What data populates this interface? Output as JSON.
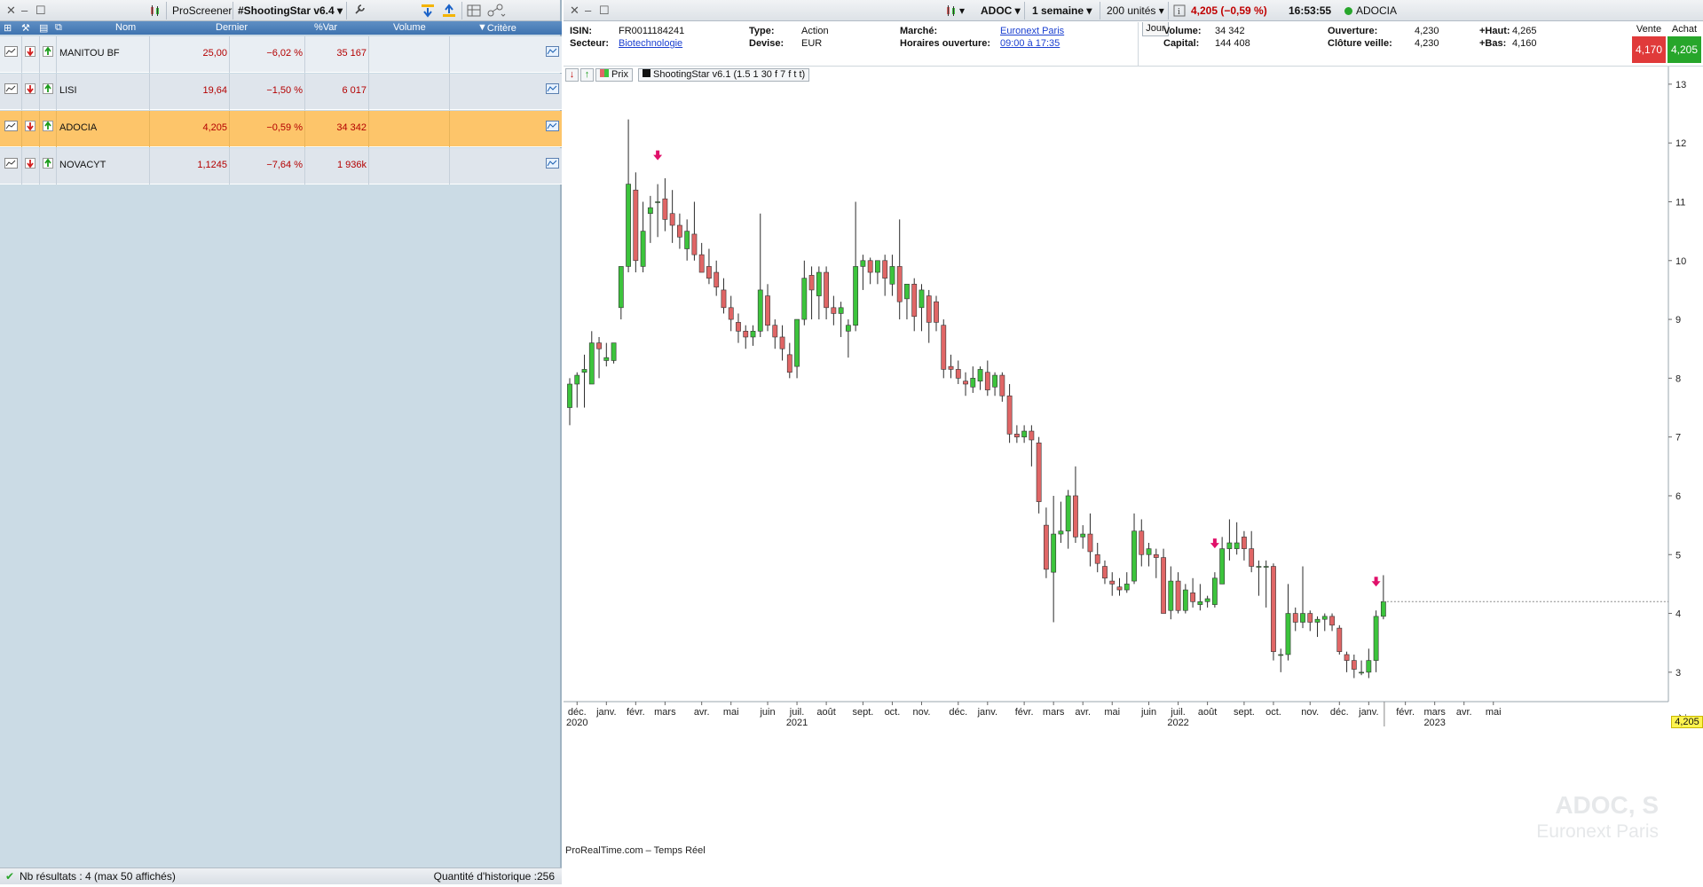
{
  "screener": {
    "name": "ProScreener",
    "screen_name": "#ShootingStar v6.4",
    "columns": [
      "Nom",
      "Dernier",
      "%Var",
      "Volume",
      "Critère"
    ],
    "rows": [
      {
        "name": "MANITOU BF",
        "last": "25,00",
        "var": "−6,02 %",
        "volume": "35 167",
        "selected": false
      },
      {
        "name": "LISI",
        "last": "19,64",
        "var": "−1,50 %",
        "volume": "6 017",
        "selected": false
      },
      {
        "name": "ADOCIA",
        "last": "4,205",
        "var": "−0,59 %",
        "volume": "34 342",
        "selected": true
      },
      {
        "name": "NOVACYT",
        "last": "1,1245",
        "var": "−7,64 %",
        "volume": "1 936k",
        "selected": false
      }
    ],
    "results_text": "Nb résultats : 4 (max 50 affichés)",
    "history_text": "Quantité d'historique :256"
  },
  "chart_header": {
    "ticker": "ADOC",
    "timeframe": "1 semaine",
    "units": "200 unités",
    "quote": "4,205 (−0,59 %)",
    "time": "16:53:55",
    "name": "ADOCIA"
  },
  "info": {
    "isin_label": "ISIN:",
    "isin": "FR0011184241",
    "secteur_label": "Secteur:",
    "secteur": "Biotechnologie",
    "type_label": "Type:",
    "type": "Action",
    "devise_label": "Devise:",
    "devise": "EUR",
    "marche_label": "Marché:",
    "marche": "Euronext Paris",
    "horaires_label": "Horaires ouverture:",
    "horaires": "09:00 à 17:35",
    "jour": "Jour",
    "volume_label": "Volume:",
    "volume": "34 342",
    "capital_label": "Capital:",
    "capital": "144 408",
    "ouverture_label": "Ouverture:",
    "ouverture": "4,230",
    "cloture_label": "Clôture veille:",
    "cloture": "4,230",
    "haut_label": "+Haut:",
    "haut": "4,265",
    "bas_label": "+Bas:",
    "bas": "4,160",
    "vente_label": "Vente",
    "vente": "4,170",
    "achat_label": "Achat",
    "achat": "4,205"
  },
  "chart_toolbar": {
    "prix": "Prix",
    "indicator": "ShootingStar v6.1 (1.5 1 30 f 7 f t t)"
  },
  "footnote": "ProRealTime.com – Temps Réel",
  "watermark": {
    "line1": "ADOC, S",
    "line2": "Euronext Paris"
  },
  "last_price_tag": "4,205",
  "colors": {
    "up": "#3cc43c",
    "down": "#e06666",
    "signal": "#e0106a",
    "selected_row": "#fdc56a"
  },
  "chart_data": {
    "type": "candlestick",
    "ylim": [
      2.5,
      13.3
    ],
    "y_ticks": [
      3,
      4,
      5,
      6,
      7,
      8,
      9,
      10,
      11,
      12,
      13
    ],
    "x_labels": [
      {
        "m": "déc.",
        "y": "2020",
        "i": 1
      },
      {
        "m": "janv.",
        "y": "",
        "i": 5
      },
      {
        "m": "févr.",
        "y": "",
        "i": 9
      },
      {
        "m": "mars",
        "y": "",
        "i": 13
      },
      {
        "m": "avr.",
        "y": "",
        "i": 18
      },
      {
        "m": "mai",
        "y": "",
        "i": 22
      },
      {
        "m": "juin",
        "y": "",
        "i": 27
      },
      {
        "m": "juil.",
        "y": "2021",
        "i": 31
      },
      {
        "m": "août",
        "y": "",
        "i": 35
      },
      {
        "m": "sept.",
        "y": "",
        "i": 40
      },
      {
        "m": "oct.",
        "y": "",
        "i": 44
      },
      {
        "m": "nov.",
        "y": "",
        "i": 48
      },
      {
        "m": "déc.",
        "y": "",
        "i": 53
      },
      {
        "m": "janv.",
        "y": "",
        "i": 57
      },
      {
        "m": "févr.",
        "y": "",
        "i": 62
      },
      {
        "m": "mars",
        "y": "",
        "i": 66
      },
      {
        "m": "avr.",
        "y": "",
        "i": 70
      },
      {
        "m": "mai",
        "y": "",
        "i": 74
      },
      {
        "m": "juin",
        "y": "",
        "i": 79
      },
      {
        "m": "juil.",
        "y": "2022",
        "i": 83
      },
      {
        "m": "août",
        "y": "",
        "i": 87
      },
      {
        "m": "sept.",
        "y": "",
        "i": 92
      },
      {
        "m": "oct.",
        "y": "",
        "i": 96
      },
      {
        "m": "nov.",
        "y": "",
        "i": 101
      },
      {
        "m": "déc.",
        "y": "",
        "i": 105
      },
      {
        "m": "janv.",
        "y": "",
        "i": 109
      },
      {
        "m": "févr.",
        "y": "",
        "i": 114
      },
      {
        "m": "mars",
        "y": "2023",
        "i": 118
      },
      {
        "m": "avr.",
        "y": "",
        "i": 122
      },
      {
        "m": "mai",
        "y": "",
        "i": 126
      }
    ],
    "signals": [
      12,
      88,
      110
    ],
    "ohlc": [
      [
        7.5,
        8.0,
        7.2,
        7.9
      ],
      [
        7.9,
        8.1,
        7.5,
        8.05
      ],
      [
        8.1,
        8.4,
        7.5,
        8.15
      ],
      [
        7.9,
        8.8,
        7.9,
        8.6
      ],
      [
        8.6,
        8.7,
        8.0,
        8.5
      ],
      [
        8.3,
        8.6,
        8.2,
        8.35
      ],
      [
        8.3,
        8.6,
        8.25,
        8.6
      ],
      [
        9.2,
        9.9,
        9.0,
        9.9
      ],
      [
        9.9,
        12.4,
        9.8,
        11.3
      ],
      [
        11.2,
        11.5,
        9.8,
        10.0
      ],
      [
        9.9,
        11.0,
        9.8,
        10.5
      ],
      [
        10.8,
        11.1,
        10.3,
        10.9
      ],
      [
        11.0,
        11.3,
        10.4,
        11.0
      ],
      [
        11.05,
        11.4,
        10.5,
        10.7
      ],
      [
        10.8,
        11.2,
        10.3,
        10.6
      ],
      [
        10.6,
        10.8,
        10.2,
        10.4
      ],
      [
        10.2,
        10.7,
        10.0,
        10.5
      ],
      [
        10.45,
        11.0,
        10.0,
        10.1
      ],
      [
        10.1,
        10.3,
        9.8,
        9.8
      ],
      [
        9.9,
        10.2,
        9.6,
        9.7
      ],
      [
        9.8,
        10.0,
        9.4,
        9.55
      ],
      [
        9.5,
        9.7,
        9.1,
        9.2
      ],
      [
        9.2,
        9.4,
        8.8,
        9.0
      ],
      [
        8.95,
        9.1,
        8.6,
        8.8
      ],
      [
        8.8,
        8.9,
        8.5,
        8.7
      ],
      [
        8.7,
        8.9,
        8.55,
        8.8
      ],
      [
        8.8,
        10.8,
        8.7,
        9.5
      ],
      [
        9.4,
        9.6,
        8.8,
        8.9
      ],
      [
        8.9,
        9.0,
        8.5,
        8.7
      ],
      [
        8.7,
        8.9,
        8.3,
        8.5
      ],
      [
        8.4,
        8.6,
        8.0,
        8.1
      ],
      [
        8.2,
        9.0,
        8.0,
        9.0
      ],
      [
        9.0,
        10.0,
        8.9,
        9.7
      ],
      [
        9.75,
        9.9,
        9.0,
        9.5
      ],
      [
        9.4,
        9.9,
        9.0,
        9.8
      ],
      [
        9.8,
        9.9,
        9.0,
        9.2
      ],
      [
        9.2,
        9.4,
        8.9,
        9.1
      ],
      [
        9.1,
        9.3,
        8.7,
        9.2
      ],
      [
        8.8,
        9.0,
        8.35,
        8.9
      ],
      [
        8.9,
        11.0,
        8.8,
        9.9
      ],
      [
        9.9,
        10.1,
        9.5,
        10.0
      ],
      [
        10.0,
        10.05,
        9.6,
        9.8
      ],
      [
        9.8,
        10.0,
        9.6,
        10.0
      ],
      [
        10.0,
        10.1,
        9.4,
        9.7
      ],
      [
        9.6,
        10.1,
        9.4,
        9.9
      ],
      [
        9.9,
        10.7,
        9.0,
        9.3
      ],
      [
        9.35,
        9.6,
        9.0,
        9.6
      ],
      [
        9.6,
        9.7,
        8.8,
        9.05
      ],
      [
        9.2,
        9.6,
        8.8,
        9.5
      ],
      [
        9.4,
        9.5,
        8.6,
        8.95
      ],
      [
        9.3,
        9.4,
        8.8,
        8.95
      ],
      [
        8.9,
        9.0,
        8.0,
        8.15
      ],
      [
        8.2,
        8.4,
        8.0,
        8.15
      ],
      [
        8.15,
        8.3,
        7.9,
        8.0
      ],
      [
        7.95,
        8.1,
        7.7,
        7.9
      ],
      [
        7.85,
        8.2,
        7.75,
        8.0
      ],
      [
        7.95,
        8.2,
        7.8,
        8.15
      ],
      [
        8.1,
        8.3,
        7.7,
        7.8
      ],
      [
        7.85,
        8.1,
        7.7,
        8.05
      ],
      [
        8.05,
        8.1,
        7.6,
        7.7
      ],
      [
        7.7,
        7.9,
        6.9,
        7.05
      ],
      [
        7.05,
        7.2,
        6.9,
        7.0
      ],
      [
        7.0,
        7.2,
        6.9,
        7.1
      ],
      [
        7.1,
        7.2,
        6.5,
        6.95
      ],
      [
        6.9,
        7.0,
        5.7,
        5.9
      ],
      [
        5.5,
        5.8,
        4.6,
        4.75
      ],
      [
        4.7,
        6.0,
        3.85,
        5.35
      ],
      [
        5.35,
        5.9,
        5.2,
        5.4
      ],
      [
        5.4,
        6.1,
        5.1,
        6.0
      ],
      [
        6.0,
        6.5,
        5.2,
        5.3
      ],
      [
        5.3,
        5.5,
        5.1,
        5.35
      ],
      [
        5.35,
        5.7,
        4.8,
        5.05
      ],
      [
        5.0,
        5.2,
        4.7,
        4.85
      ],
      [
        4.8,
        4.9,
        4.5,
        4.6
      ],
      [
        4.55,
        4.7,
        4.3,
        4.5
      ],
      [
        4.45,
        4.6,
        4.3,
        4.4
      ],
      [
        4.4,
        4.7,
        4.35,
        4.5
      ],
      [
        4.55,
        5.7,
        4.5,
        5.4
      ],
      [
        5.4,
        5.6,
        4.8,
        5.0
      ],
      [
        5.0,
        5.2,
        4.8,
        5.1
      ],
      [
        5.0,
        5.1,
        4.6,
        4.95
      ],
      [
        4.95,
        5.1,
        4.0,
        4.0
      ],
      [
        4.05,
        4.8,
        3.9,
        4.55
      ],
      [
        4.55,
        4.7,
        4.0,
        4.05
      ],
      [
        4.05,
        4.5,
        4.0,
        4.4
      ],
      [
        4.35,
        4.6,
        4.1,
        4.2
      ],
      [
        4.15,
        4.5,
        4.05,
        4.2
      ],
      [
        4.2,
        4.3,
        4.1,
        4.25
      ],
      [
        4.15,
        4.7,
        4.1,
        4.6
      ],
      [
        4.5,
        5.3,
        4.5,
        5.1
      ],
      [
        5.1,
        5.6,
        4.9,
        5.2
      ],
      [
        5.1,
        5.55,
        5.0,
        5.2
      ],
      [
        5.3,
        5.4,
        4.9,
        5.1
      ],
      [
        5.1,
        5.4,
        4.7,
        4.8
      ],
      [
        4.8,
        4.9,
        4.3,
        4.8
      ],
      [
        4.8,
        4.9,
        4.1,
        4.8
      ],
      [
        4.8,
        4.85,
        3.2,
        3.35
      ],
      [
        3.3,
        3.4,
        3.0,
        3.3
      ],
      [
        3.3,
        4.5,
        3.2,
        4.0
      ],
      [
        4.0,
        4.1,
        3.7,
        3.85
      ],
      [
        3.85,
        4.8,
        3.75,
        4.0
      ],
      [
        4.0,
        4.05,
        3.7,
        3.85
      ],
      [
        3.85,
        3.95,
        3.6,
        3.9
      ],
      [
        3.9,
        4.0,
        3.7,
        3.95
      ],
      [
        3.95,
        4.0,
        3.7,
        3.8
      ],
      [
        3.75,
        3.8,
        3.3,
        3.35
      ],
      [
        3.3,
        3.35,
        3.0,
        3.2
      ],
      [
        3.2,
        3.3,
        2.9,
        3.05
      ],
      [
        3.0,
        3.2,
        2.95,
        3.0
      ],
      [
        3.0,
        3.4,
        2.9,
        3.2
      ],
      [
        3.2,
        4.05,
        3.0,
        3.95
      ],
      [
        3.95,
        4.65,
        3.9,
        4.2
      ]
    ]
  }
}
